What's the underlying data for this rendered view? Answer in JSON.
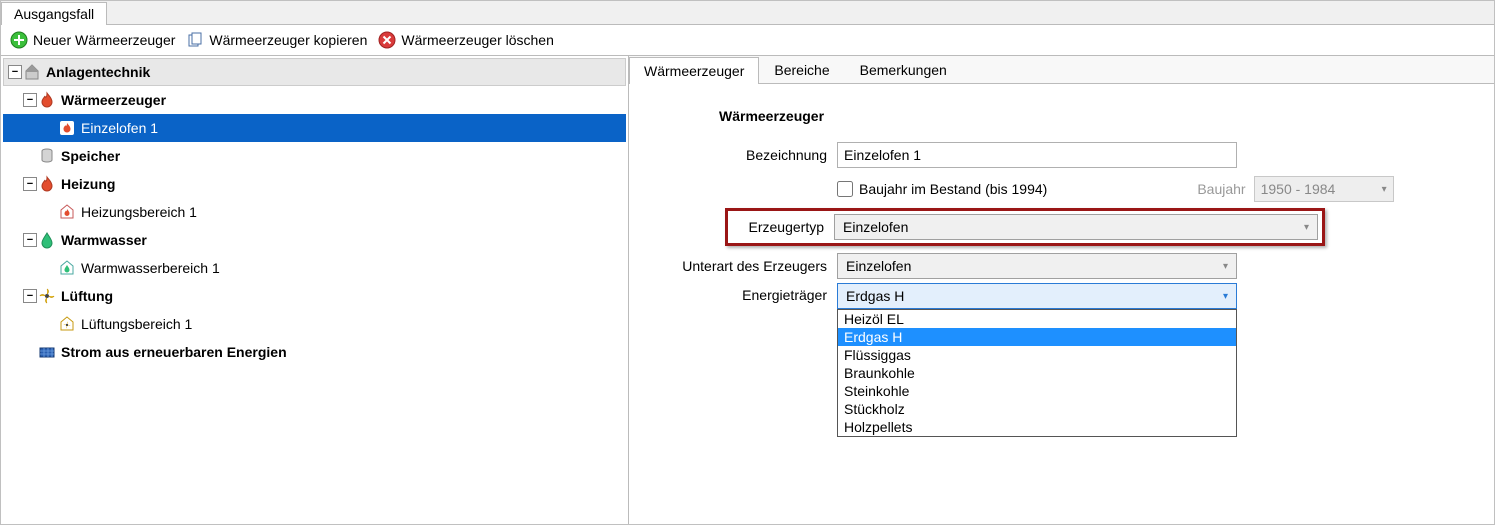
{
  "top_tab": "Ausgangsfall",
  "toolbar": {
    "new": "Neuer Wärmeerzeuger",
    "copy": "Wärmeerzeuger kopieren",
    "delete": "Wärmeerzeuger löschen"
  },
  "tree": {
    "root": "Anlagentechnik",
    "waermeerzeuger": "Wärmeerzeuger",
    "einzelofen1": "Einzelofen 1",
    "speicher": "Speicher",
    "heizung": "Heizung",
    "heizungsbereich1": "Heizungsbereich 1",
    "warmwasser": "Warmwasser",
    "warmwasserbereich1": "Warmwasserbereich 1",
    "lueftung": "Lüftung",
    "lueftungsbereich1": "Lüftungsbereich 1",
    "strom": "Strom aus erneuerbaren Energien"
  },
  "detail_tabs": {
    "t1": "Wärmeerzeuger",
    "t2": "Bereiche",
    "t3": "Bemerkungen"
  },
  "form": {
    "section": "Wärmeerzeuger",
    "bezeichnung_label": "Bezeichnung",
    "bezeichnung_value": "Einzelofen 1",
    "baujahr_chk_label": "Baujahr im Bestand (bis 1994)",
    "baujahr_label": "Baujahr",
    "baujahr_value": "1950 - 1984",
    "erzeugertyp_label": "Erzeugertyp",
    "erzeugertyp_value": "Einzelofen",
    "unterart_label": "Unterart des Erzeugers",
    "unterart_value": "Einzelofen",
    "energietraeger_label": "Energieträger",
    "energietraeger_value": "Erdgas H",
    "options": {
      "o1": "Heizöl EL",
      "o2": "Erdgas H",
      "o3": "Flüssiggas",
      "o4": "Braunkohle",
      "o5": "Steinkohle",
      "o6": "Stückholz",
      "o7": "Holzpellets"
    }
  }
}
